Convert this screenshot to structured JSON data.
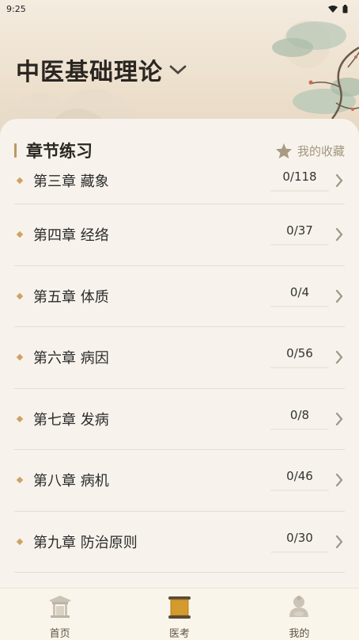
{
  "status_bar": {
    "time": "9:25"
  },
  "header": {
    "title": "中医基础理论"
  },
  "section": {
    "title": "章节练习",
    "favorites_label": "我的收藏"
  },
  "chapters": [
    {
      "label": "第三章 藏象",
      "progress": "0/118"
    },
    {
      "label": "第四章 经络",
      "progress": "0/37"
    },
    {
      "label": "第五章 体质",
      "progress": "0/4"
    },
    {
      "label": "第六章 病因",
      "progress": "0/56"
    },
    {
      "label": "第七章 发病",
      "progress": "0/8"
    },
    {
      "label": "第八章 病机",
      "progress": "0/46"
    },
    {
      "label": "第九章 防治原则",
      "progress": "0/30"
    }
  ],
  "tabbar": {
    "tabs": [
      {
        "label": "首页",
        "icon": "pavilion-icon"
      },
      {
        "label": "医考",
        "icon": "scroll-icon",
        "active": true
      },
      {
        "label": "我的",
        "icon": "buddha-icon"
      }
    ]
  },
  "colors": {
    "accent": "#cfa264",
    "card_bg": "#f7f3ec",
    "hero_bg": "#ede0cd"
  }
}
